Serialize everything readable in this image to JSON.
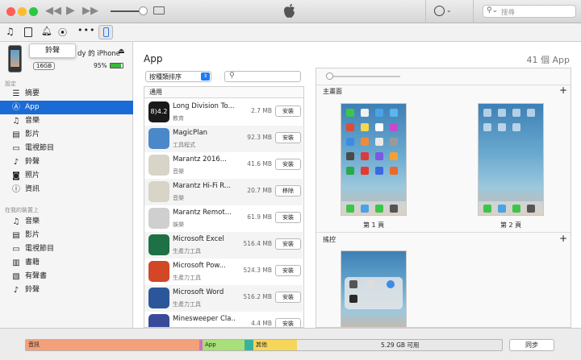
{
  "toolbar": {
    "search_placeholder": "搜尋",
    "tooltip": "鈴聲"
  },
  "device": {
    "name": "dy 的 iPhone",
    "capacity": "16GB",
    "battery": "95%"
  },
  "sidebar": {
    "section_settings": "設定",
    "settings_items": [
      {
        "label": "摘要",
        "icon": "list-icon"
      },
      {
        "label": "App",
        "icon": "app-store-icon"
      },
      {
        "label": "音樂",
        "icon": "music-note-icon"
      },
      {
        "label": "影片",
        "icon": "film-icon"
      },
      {
        "label": "電視節目",
        "icon": "tv-icon"
      },
      {
        "label": "鈴聲",
        "icon": "bell-icon"
      },
      {
        "label": "照片",
        "icon": "camera-icon"
      },
      {
        "label": "資訊",
        "icon": "info-icon"
      }
    ],
    "section_device": "在我的裝置上",
    "device_items": [
      {
        "label": "音樂",
        "icon": "music-note-icon"
      },
      {
        "label": "影片",
        "icon": "film-icon"
      },
      {
        "label": "電視節目",
        "icon": "tv-icon"
      },
      {
        "label": "書籍",
        "icon": "book-icon"
      },
      {
        "label": "有聲書",
        "icon": "audiobook-icon"
      },
      {
        "label": "鈴聲",
        "icon": "bell-icon"
      }
    ]
  },
  "main": {
    "title": "App",
    "count": "41 個 App",
    "sort_label": "按種類排序",
    "list_header": "通用",
    "apps": [
      {
        "name": "Long Division To...",
        "category": "教育",
        "size": "2.7 MB",
        "action": "安裝",
        "color": "#1a1a1a"
      },
      {
        "name": "MagicPlan",
        "category": "工具程式",
        "size": "92.3 MB",
        "action": "安裝",
        "color": "#4a88c9"
      },
      {
        "name": "Marantz 2016...",
        "category": "音樂",
        "size": "41.6 MB",
        "action": "安裝",
        "color": "#d9d4c8"
      },
      {
        "name": "Marantz Hi-Fi R...",
        "category": "音樂",
        "size": "20.7 MB",
        "action": "移除",
        "color": "#d9d4c8"
      },
      {
        "name": "Marantz Remot...",
        "category": "娛樂",
        "size": "61.9 MB",
        "action": "安裝",
        "color": "#cfcfcf"
      },
      {
        "name": "Microsoft Excel",
        "category": "生產力工具",
        "size": "516.4 MB",
        "action": "安裝",
        "color": "#1e7145"
      },
      {
        "name": "Microsoft Pow...",
        "category": "生產力工具",
        "size": "524.3 MB",
        "action": "安裝",
        "color": "#d24726"
      },
      {
        "name": "Microsoft Word",
        "category": "生產力工具",
        "size": "516.2 MB",
        "action": "安裝",
        "color": "#2b579a"
      },
      {
        "name": "Minesweeper Cla...",
        "category": "",
        "size": "4.4 MB",
        "action": "安裝",
        "color": "#3a4a9a"
      }
    ],
    "home_header": "主畫面",
    "page1": "第 1 頁",
    "page2": "第 2 頁",
    "dock_header": "搖控"
  },
  "storage": {
    "segments": [
      {
        "label": "音訊",
        "color": "#f4a07a"
      },
      {
        "label": "",
        "color": "#d070c0"
      },
      {
        "label": "App",
        "color": "#a8df78"
      },
      {
        "label": "",
        "color": "#39b39a"
      },
      {
        "label": "其他",
        "color": "#f5d65a"
      }
    ],
    "free": "5.29 GB 可用",
    "sync": "同步"
  }
}
